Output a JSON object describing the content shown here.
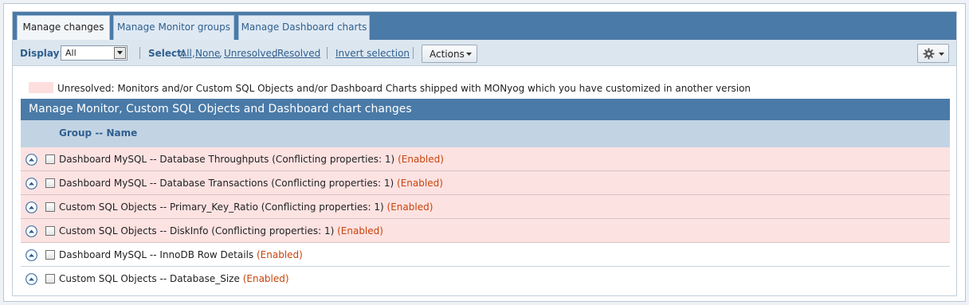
{
  "tabs": [
    {
      "label": "Manage changes",
      "active": true
    },
    {
      "label": "Manage Monitor groups",
      "active": false
    },
    {
      "label": "Manage Dashboard charts",
      "active": false
    }
  ],
  "toolbar": {
    "display_label": "Display:",
    "display_value": "All",
    "select_label": "Select:",
    "select_links": [
      "All",
      "None",
      "Unresolved",
      "Resolved"
    ],
    "invert_label": "Invert selection",
    "actions_label": "Actions"
  },
  "legend": {
    "color": "#fcdede",
    "text": "Unresolved: Monitors and/or Custom SQL Objects and/or Dashboard Charts shipped with MONyog which you have customized in another version"
  },
  "grid": {
    "title": "Manage Monitor, Custom SQL Objects and Dashboard chart changes",
    "column_header": "Group -- Name",
    "rows": [
      {
        "name": "Dashboard MySQL -- Database Throughputs (Conflicting properties: 1)",
        "status": "(Enabled)",
        "conflict": true
      },
      {
        "name": "Dashboard MySQL -- Database Transactions (Conflicting properties: 1)",
        "status": "(Enabled)",
        "conflict": true
      },
      {
        "name": "Custom SQL Objects -- Primary_Key_Ratio (Conflicting properties: 1)",
        "status": "(Enabled)",
        "conflict": true
      },
      {
        "name": "Custom SQL Objects -- DiskInfo (Conflicting properties: 1)",
        "status": "(Enabled)",
        "conflict": true
      },
      {
        "name": "Dashboard MySQL -- InnoDB Row Details",
        "status": "(Enabled)",
        "conflict": false
      },
      {
        "name": "Custom SQL Objects -- Database_Size",
        "status": "(Enabled)",
        "conflict": false
      }
    ]
  },
  "colors": {
    "header_blue": "#4a7aa7",
    "conflict_row": "#fde2e2",
    "status_text": "#c8440a"
  }
}
